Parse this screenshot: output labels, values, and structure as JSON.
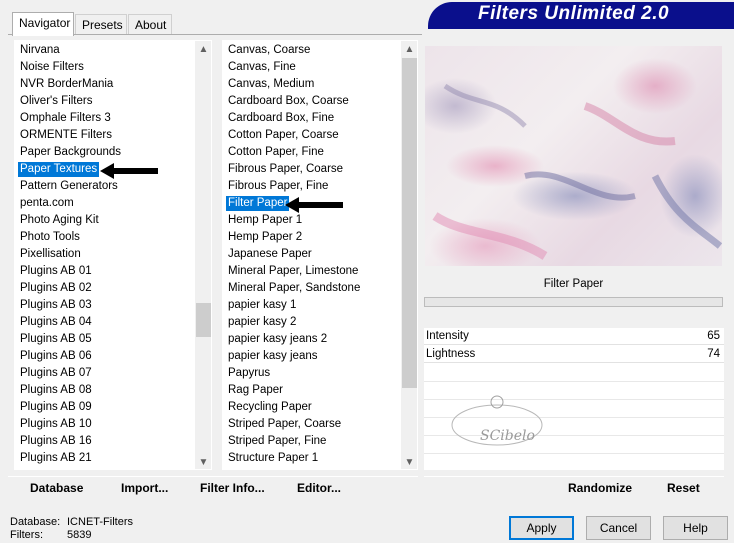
{
  "tabs": [
    "Navigator",
    "Presets",
    "About"
  ],
  "app_title": "Filters Unlimited 2.0",
  "categories": [
    "Nirvana",
    "Noise Filters",
    "NVR BorderMania",
    "Oliver's Filters",
    "Omphale Filters 3",
    "ORMENTE Filters",
    "Paper Backgrounds",
    "Paper Textures",
    "Pattern Generators",
    "penta.com",
    "Photo Aging Kit",
    "Photo Tools",
    "Pixellisation",
    "Plugins AB 01",
    "Plugins AB 02",
    "Plugins AB 03",
    "Plugins AB 04",
    "Plugins AB 05",
    "Plugins AB 06",
    "Plugins AB 07",
    "Plugins AB 08",
    "Plugins AB 09",
    "Plugins AB 10",
    "Plugins AB 16",
    "Plugins AB 21"
  ],
  "selected_category": "Paper Textures",
  "filters": [
    "Canvas, Coarse",
    "Canvas, Fine",
    "Canvas, Medium",
    "Cardboard Box, Coarse",
    "Cardboard Box, Fine",
    "Cotton Paper, Coarse",
    "Cotton Paper, Fine",
    "Fibrous Paper, Coarse",
    "Fibrous Paper, Fine",
    "Filter Paper",
    "Hemp Paper 1",
    "Hemp Paper 2",
    "Japanese Paper",
    "Mineral Paper, Limestone",
    "Mineral Paper, Sandstone",
    "papier kasy 1",
    "papier kasy 2",
    "papier kasy jeans 2",
    "papier kasy jeans",
    "Papyrus",
    "Rag Paper",
    "Recycling Paper",
    "Striped Paper, Coarse",
    "Striped Paper, Fine",
    "Structure Paper 1"
  ],
  "selected_filter": "Filter Paper",
  "filter_title": "Filter Paper",
  "params": [
    {
      "name": "Intensity",
      "value": "65"
    },
    {
      "name": "Lightness",
      "value": "74"
    }
  ],
  "watermark": "SCibelo",
  "bottom_left_buttons": {
    "database": "Database",
    "import": "Import...",
    "filter_info": "Filter Info...",
    "editor": "Editor..."
  },
  "bottom_right_buttons": {
    "randomize": "Randomize",
    "reset": "Reset"
  },
  "status": {
    "database_label": "Database:",
    "database_value": "ICNET-Filters",
    "filters_label": "Filters:",
    "filters_value": "5839"
  },
  "dialog_buttons": {
    "apply": "Apply",
    "cancel": "Cancel",
    "help": "Help"
  },
  "colors": {
    "banner": "#0a0f8c",
    "selection": "#0078d7"
  }
}
